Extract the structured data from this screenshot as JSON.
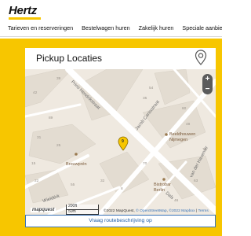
{
  "brand": {
    "logo": "Hertz"
  },
  "nav": {
    "items": [
      "Tarieven en reserveringen",
      "Bestelwagen huren",
      "Zakelijk huren",
      "Speciale aanbied"
    ]
  },
  "pickup": {
    "title": "Pickup Locaties",
    "pin_icon": "map-pin-icon"
  },
  "map": {
    "zoom_in": "+",
    "zoom_out": "−",
    "streets": {
      "prins_hendrikstraat": "Prins Hendrikstraat",
      "jacob_canisstraat": "Jacob Canisstraat",
      "van_der_havenstraat": "van der Havenstr",
      "wielderk": "Wieldérk",
      "berg_dalseweg": "Dals"
    },
    "pois": {
      "brouwpren": "Brouwprén",
      "beeldhouwen": "Beeldhouwen\nNijmegen",
      "bistrobar": "Bistrobar\nBerlin",
      "marker_label": "9"
    },
    "house_numbers": [
      "39",
      "42",
      "54",
      "60",
      "35",
      "89",
      "48",
      "31",
      "78",
      "25",
      "70",
      "32",
      "55",
      "8",
      "22",
      "63",
      "15",
      "46"
    ],
    "scale": {
      "imperial": "200ft",
      "metric": "50m"
    },
    "attribution": {
      "prefix": "©2022 MapQuest, ",
      "osm": "© OpenStreetMap",
      "sep1": ", ",
      "mapbox": "©2022 Mapbox",
      "sep2": " | ",
      "terms": "Terms"
    },
    "provider_logo": "mapquest"
  },
  "route_button": {
    "label": "Vraag routebeschrijving op"
  },
  "colors": {
    "brand_yellow": "#f7c600",
    "link_blue": "#1f5ea8",
    "map_background": "#efe9e0"
  }
}
